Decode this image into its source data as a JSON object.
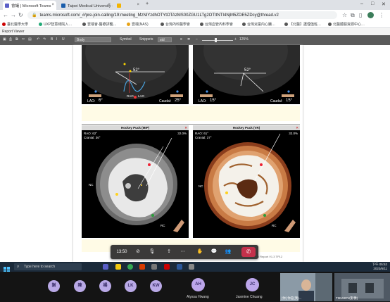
{
  "browser": {
    "tabs": [
      {
        "title": "會議 | Microsoft Teams",
        "active": true
      },
      {
        "title": "Taipei Medical University - 護...",
        "active": false
      },
      {
        "title": "",
        "active": false
      }
    ],
    "new_tab": "+",
    "window_controls": [
      "–",
      "□",
      "✕"
    ],
    "url": "teams.microsoft.com/_#/pre-join-calling/19:meeting_MzNlYzdhOTYtOTAzMS00ZGU1LTg2OTItNTI4NjM5ZDE5ZDcy@thread.v2"
  },
  "bookmarks": [
    {
      "label": "臺北醫學大學",
      "color": "#c00"
    },
    {
      "label": "UXP智慧總院入…",
      "color": "#2a7"
    },
    {
      "label": "雲端會-醫療評鑑…",
      "color": "#555"
    },
    {
      "label": "雲端(NAS)",
      "color": "#e8a317"
    },
    {
      "label": "台灣內科醫學會",
      "color": "#555"
    },
    {
      "label": "台灣血管內科學會",
      "color": "#555"
    },
    {
      "label": "台灣兒童內心臟…",
      "color": "#555"
    },
    {
      "label": "【北醫】護理值班…",
      "color": "#555"
    },
    {
      "label": "北醫體驗資源中心…",
      "color": "#555"
    }
  ],
  "report_viewer": {
    "title": "Report Viewer",
    "toolbar": {
      "page_label": "Body",
      "symbol_label": "Symbol",
      "snippets_label": "Snippets",
      "size_label": "std",
      "zoom": "125%"
    },
    "panels_top": [
      {
        "angle": "52°",
        "lao": "LAO:",
        "lao_val": "6°",
        "caudal": "Caudal:",
        "caudal_val": "25°",
        "rao": "RAO",
        "lao2": "LAO"
      },
      {
        "angle": "52°",
        "lao": "LAO:",
        "lao_val": "15°",
        "caudal": "Caudal:",
        "caudal_val": "15°"
      }
    ],
    "panels_bottom": [
      {
        "title": "Hockey Puck (MIP)",
        "rao": "RAO: 62°",
        "cranial": "Cranial: 36°",
        "pct": "32.0%",
        "nc": "NC",
        "rc": "RC"
      },
      {
        "title": "Hockey Puck (VR)",
        "rao": "RAO: 61°",
        "cranial": "Cranial: 37°",
        "pct": "32.0%",
        "nc": "NC",
        "rc": "RC"
      }
    ],
    "footer_text": "Cardiac Structural Report V1.3  TP12"
  },
  "meeting_controls": {
    "time": "13:50",
    "buttons": [
      "camera-off",
      "mic-off",
      "share",
      "more",
      "raise-hand",
      "chat",
      "people"
    ],
    "leave": "✆"
  },
  "taskbar": {
    "search_placeholder": "Type here to search",
    "time": "下午 05:52",
    "date": "2023/6/11"
  },
  "participants": [
    {
      "initials": "謝"
    },
    {
      "initials": "陳"
    },
    {
      "initials": "楊"
    },
    {
      "initials": "LK"
    },
    {
      "initials": "KW"
    },
    {
      "initials": "AH",
      "name": "Alyssa Hwang"
    },
    {
      "initials": "JC",
      "name": "Jasmine Chuang"
    }
  ],
  "video_tiles": [
    {
      "name": "[你] 你是(我)..."
    },
    {
      "name": "TMUHCV(影像)"
    }
  ]
}
